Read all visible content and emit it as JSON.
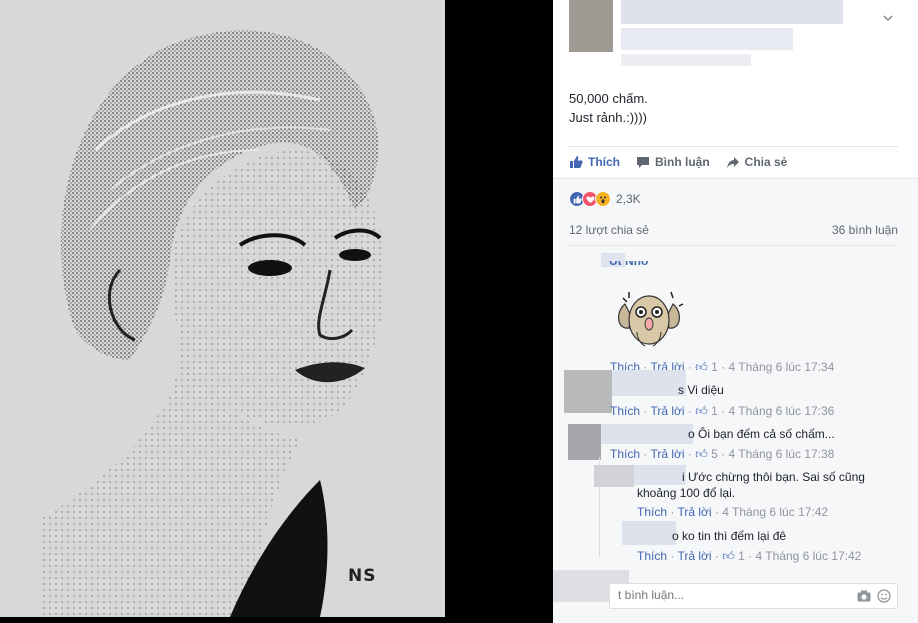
{
  "photo": {
    "signature": "NS"
  },
  "post": {
    "caption_line1": "50,000 chấm.",
    "caption_line2": "Just rảnh.:))))"
  },
  "actions": {
    "like": "Thích",
    "comment": "Bình luận",
    "share": "Chia sẻ"
  },
  "reactions": {
    "count": "2,3K",
    "types": [
      "like",
      "love",
      "wow"
    ]
  },
  "stats": {
    "shares": "12 lượt chia sẻ",
    "comments": "36 bình luận"
  },
  "comments": [
    {
      "author_partial": "Út Nhỏ",
      "text": "",
      "like_label": "Thích",
      "reply_label": "Trả lời",
      "likes": "1",
      "time": "4 Tháng 6 lúc 17:34"
    },
    {
      "text": "s Vi diệu",
      "like_label": "Thích",
      "reply_label": "Trả lời",
      "likes": "1",
      "time": "4 Tháng 6 lúc 17:36"
    },
    {
      "text": "o Ôi bạn đếm cả số chấm...",
      "like_label": "Thích",
      "reply_label": "Trả lời",
      "likes": "5",
      "time": "4 Tháng 6 lúc 17:38"
    },
    {
      "text_line1": "i Ước chừng thôi bạn. Sai số cũng",
      "text_line2": "khoảng 100 đổ lại.",
      "like_label": "Thích",
      "reply_label": "Trả lời",
      "time": "4 Tháng 6 lúc 17:42"
    },
    {
      "text": "o ko tin thì đếm lại đê",
      "like_label": "Thích",
      "reply_label": "Trả lời",
      "likes": "1",
      "time": "4 Tháng 6 lúc 17:42"
    }
  ],
  "composer": {
    "placeholder": "t bình luận..."
  },
  "colors": {
    "link": "#4267b2",
    "meta": "#90949c",
    "like_reaction": "#4267b2",
    "love_reaction": "#f25268",
    "wow_reaction": "#f7b125"
  }
}
